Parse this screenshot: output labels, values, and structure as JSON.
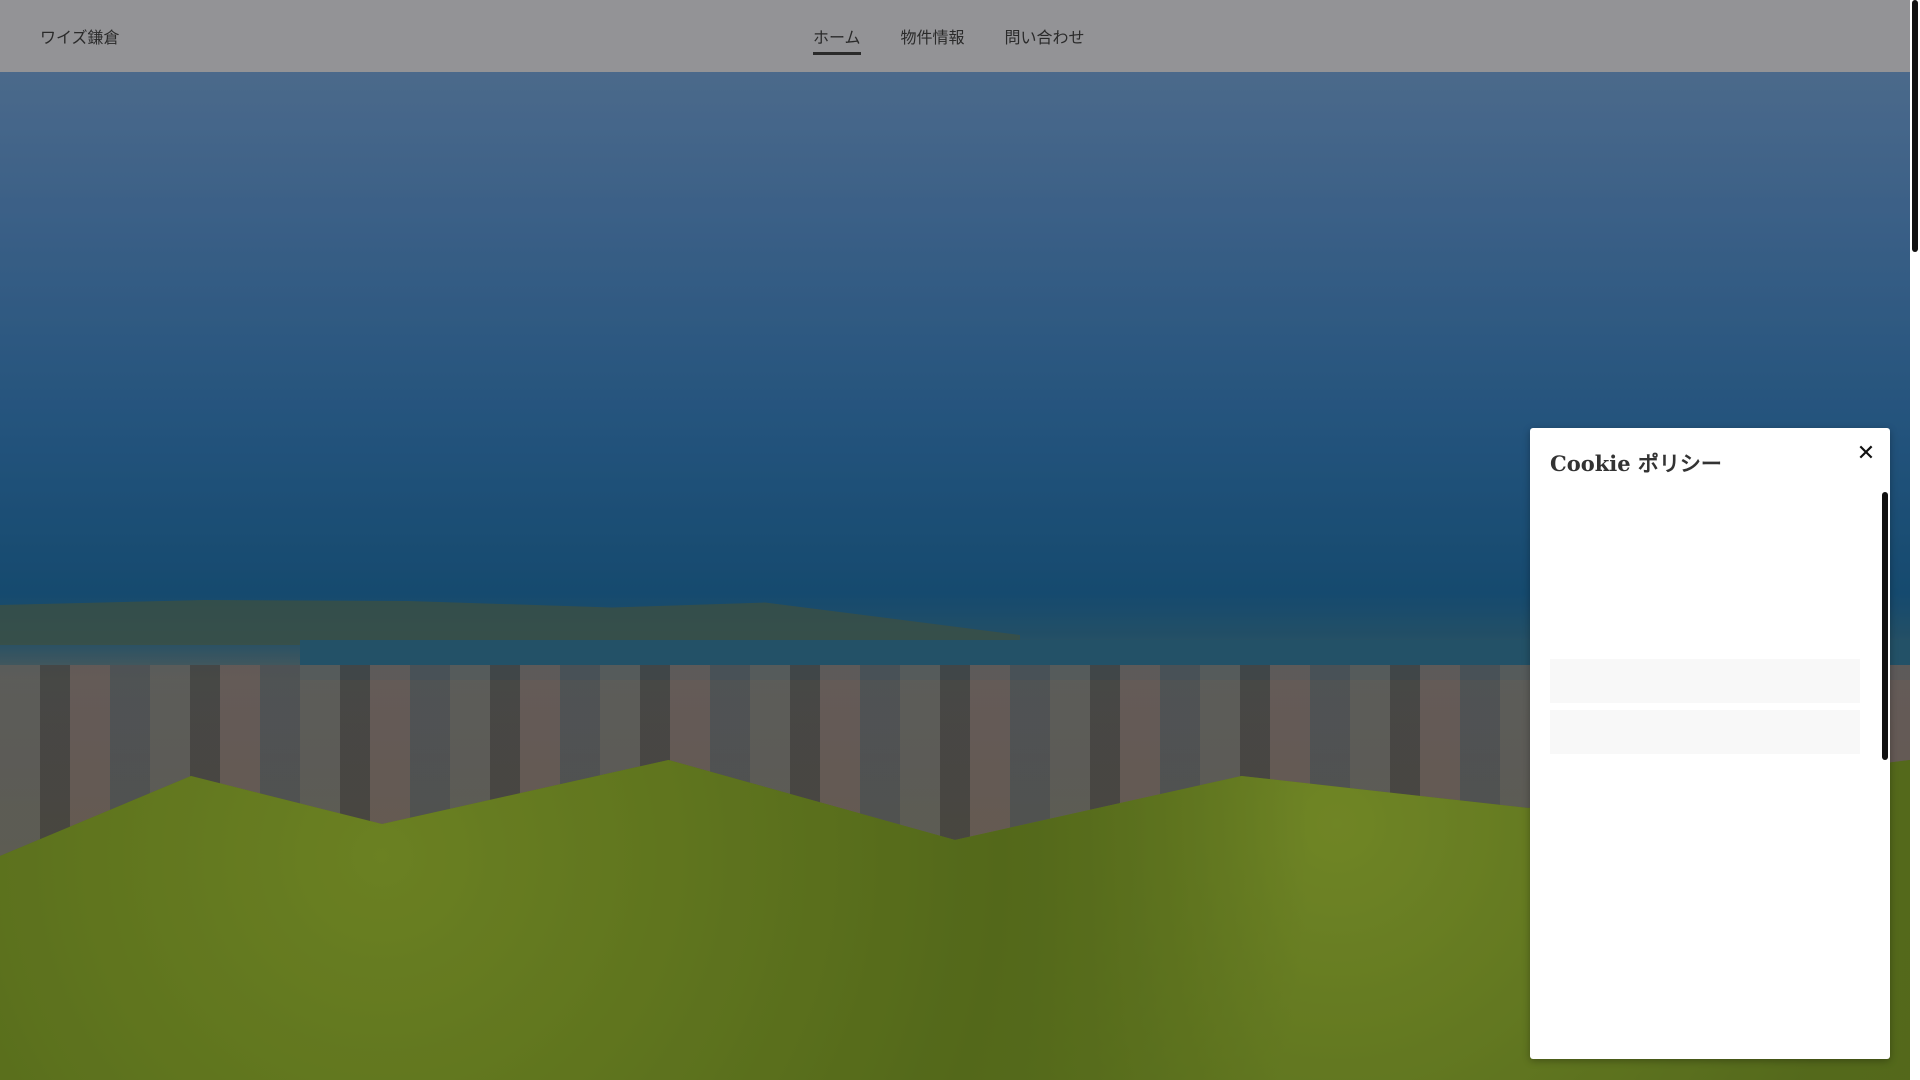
{
  "header": {
    "logo": "ワイズ鎌倉",
    "nav": [
      {
        "label": "ホーム",
        "active": true
      },
      {
        "label": "物件情報"
      },
      {
        "label": "問い合わせ"
      }
    ]
  },
  "cookie_panel": {
    "title": "Cookie ポリシー",
    "close_icon": "close-icon"
  }
}
